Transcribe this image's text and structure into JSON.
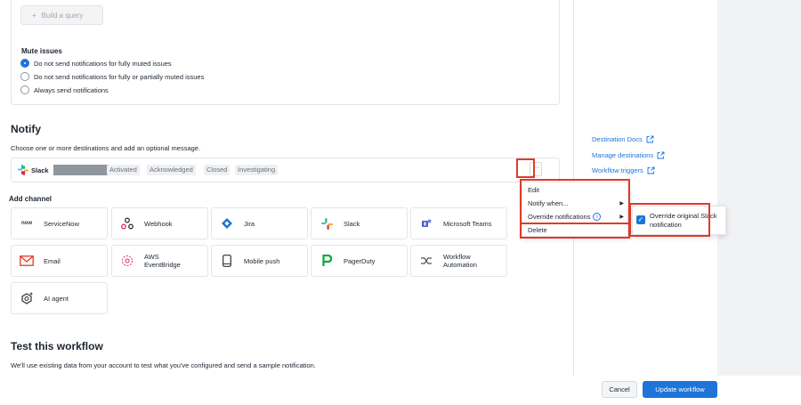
{
  "query": {
    "build_label": "Build a query",
    "plus_icon": "plus-icon"
  },
  "mute": {
    "title": "Mute issues",
    "options": [
      "Do not send notifications for fully muted issues",
      "Do not send notifications for fully or partially muted issues",
      "Always send notifications"
    ],
    "selected_index": 0
  },
  "notify": {
    "title": "Notify",
    "subtitle": "Choose one or more destinations and add an optional message.",
    "destination": {
      "name": "Slack",
      "states": [
        "Activated",
        "Acknowledged",
        "Closed",
        "Investigating"
      ],
      "more_label": "···"
    },
    "add_channel_title": "Add channel",
    "channels": [
      {
        "label": "ServiceNow",
        "icon": "servicenow-icon"
      },
      {
        "label": "Webhook",
        "icon": "webhook-icon"
      },
      {
        "label": "Jira",
        "icon": "jira-icon"
      },
      {
        "label": "Slack",
        "icon": "slack-icon"
      },
      {
        "label": "Microsoft Teams",
        "icon": "teams-icon"
      },
      {
        "label": "Email",
        "icon": "email-icon"
      },
      {
        "label": "AWS EventBridge",
        "icon": "aws-eventbridge-icon"
      },
      {
        "label": "Mobile push",
        "icon": "mobile-icon"
      },
      {
        "label": "PagerDuty",
        "icon": "pagerduty-icon"
      },
      {
        "label": "Workflow Automation",
        "icon": "workflow-automation-icon"
      },
      {
        "label": "AI agent",
        "icon": "ai-agent-icon"
      }
    ],
    "servicenow_logo_text": "now"
  },
  "test": {
    "title": "Test this workflow",
    "subtitle": "We'll use existing data from your account to test what you've configured and send a sample notification."
  },
  "links": [
    "Destination Docs",
    "Manage destinations",
    "Workflow triggers"
  ],
  "menu": {
    "items": [
      "Edit",
      "Notify when...",
      "Override notifications",
      "Delete"
    ],
    "info_glyph": "i",
    "submenu_arrow": "▶"
  },
  "submenu": {
    "checkbox_label": "Override original Slack notification",
    "checked": true
  },
  "footer": {
    "cancel_label": "Cancel",
    "update_label": "Update workflow"
  },
  "colors": {
    "accent": "#1f74d9",
    "highlight": "#e03a2a"
  }
}
